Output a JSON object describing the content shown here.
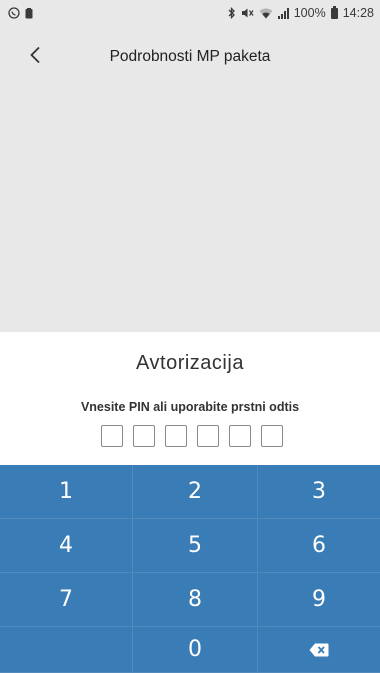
{
  "status_bar": {
    "battery_percent": "100%",
    "time": "14:28"
  },
  "header": {
    "title": "Podrobnosti MP paketa",
    "back_icon": "chevron-left-icon"
  },
  "auth": {
    "title": "Avtorizacija",
    "subtitle": "Vnesite PIN ali uporabite prstni odtis",
    "pin_length": 6
  },
  "keypad": {
    "keys": [
      "1",
      "2",
      "3",
      "4",
      "5",
      "6",
      "7",
      "8",
      "9",
      "",
      "0",
      "backspace"
    ],
    "backspace_icon": "backspace-icon"
  },
  "colors": {
    "keypad_bg": "#3a7cb5",
    "screen_bg": "#e8e8e8",
    "panel_bg": "#ffffff"
  }
}
